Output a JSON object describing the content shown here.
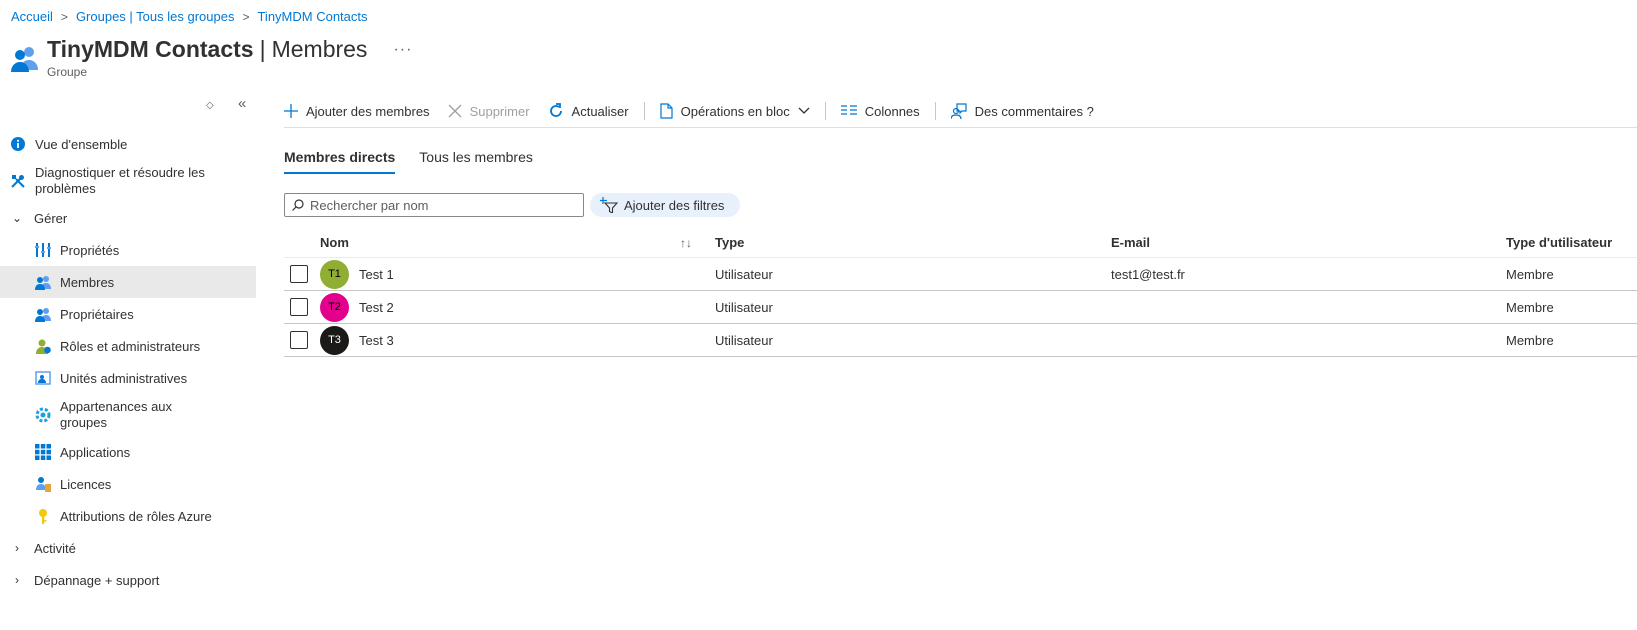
{
  "breadcrumb": [
    {
      "label": "Accueil"
    },
    {
      "label": "Groupes | Tous les groupes"
    },
    {
      "label": "TinyMDM Contacts"
    }
  ],
  "header": {
    "title": "TinyMDM Contacts",
    "separator": "|",
    "section": "Membres",
    "more": "···",
    "subtitle": "Groupe"
  },
  "sidebar": {
    "sort_icon": "updown-icon",
    "collapse_icon": "double-chevron-left-icon",
    "items": [
      {
        "label": "Vue d'ensemble",
        "icon": "info-icon"
      },
      {
        "label": "Diagnostiquer et résoudre les problèmes",
        "icon": "wrench-icon"
      },
      {
        "label": "Gérer",
        "icon": "chevron-down-icon"
      },
      {
        "label": "Propriétés",
        "icon": "properties-icon"
      },
      {
        "label": "Membres",
        "icon": "members-icon"
      },
      {
        "label": "Propriétaires",
        "icon": "owners-icon"
      },
      {
        "label": "Rôles et administrateurs",
        "icon": "roles-icon"
      },
      {
        "label": "Unités administratives",
        "icon": "admin-units-icon"
      },
      {
        "label": "Appartenances aux groupes",
        "icon": "gear-icon"
      },
      {
        "label": "Applications",
        "icon": "grid-icon"
      },
      {
        "label": "Licences",
        "icon": "license-icon"
      },
      {
        "label": "Attributions de rôles Azure",
        "icon": "key-icon"
      },
      {
        "label": "Activité",
        "icon": "chevron-right-icon"
      },
      {
        "label": "Dépannage + support",
        "icon": "chevron-right-icon"
      }
    ],
    "active": "Membres"
  },
  "toolbar": {
    "add": "Ajouter des membres",
    "delete": "Supprimer",
    "refresh": "Actualiser",
    "bulk": "Opérations en bloc",
    "columns": "Colonnes",
    "feedback": "Des commentaires ?"
  },
  "tabs": [
    {
      "label": "Membres directs",
      "active": true
    },
    {
      "label": "Tous les membres",
      "active": false
    }
  ],
  "search": {
    "placeholder": "Rechercher par nom",
    "value": ""
  },
  "filter": {
    "label": "Ajouter des filtres"
  },
  "table": {
    "headers": {
      "name": "Nom",
      "type": "Type",
      "email": "E-mail",
      "user_type": "Type d'utilisateur"
    },
    "rows": [
      {
        "initials": "T1",
        "name": "Test 1",
        "type": "Utilisateur",
        "email": "test1@test.fr",
        "user_type": "Membre",
        "avatar_color": "#8fae33"
      },
      {
        "initials": "T2",
        "name": "Test 2",
        "type": "Utilisateur",
        "email": "",
        "user_type": "Membre",
        "avatar_color": "#e3008c"
      },
      {
        "initials": "T3",
        "name": "Test 3",
        "type": "Utilisateur",
        "email": "",
        "user_type": "Membre",
        "avatar_color": "#1b1a19"
      }
    ]
  },
  "colors": {
    "accent": "#0078d4",
    "active_bg": "#e9e9e9"
  }
}
